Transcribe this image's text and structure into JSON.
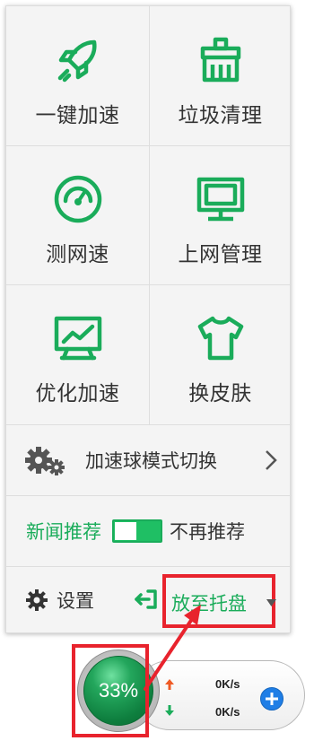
{
  "tiles": [
    {
      "label": "一键加速",
      "icon": "rocket-icon"
    },
    {
      "label": "垃圾清理",
      "icon": "broom-icon"
    },
    {
      "label": "测网速",
      "icon": "speedometer-icon"
    },
    {
      "label": "上网管理",
      "icon": "monitor-icon"
    },
    {
      "label": "优化加速",
      "icon": "chart-monitor-icon"
    },
    {
      "label": "换皮肤",
      "icon": "tshirt-icon"
    }
  ],
  "mode_switch": {
    "label": "加速球模式切换",
    "icon": "gears-icon"
  },
  "news": {
    "label": "新闻推荐",
    "toggle_on": true,
    "no_recommend_label": "不再推荐"
  },
  "footer": {
    "settings_label": "设置",
    "tray_label": "放至托盘"
  },
  "ball": {
    "percent": "33%",
    "upload": "0K/s",
    "download": "0K/s"
  },
  "colors": {
    "accent": "#1aac5a",
    "highlight_box": "#e8232d",
    "plus_button": "#1f7ee6"
  }
}
